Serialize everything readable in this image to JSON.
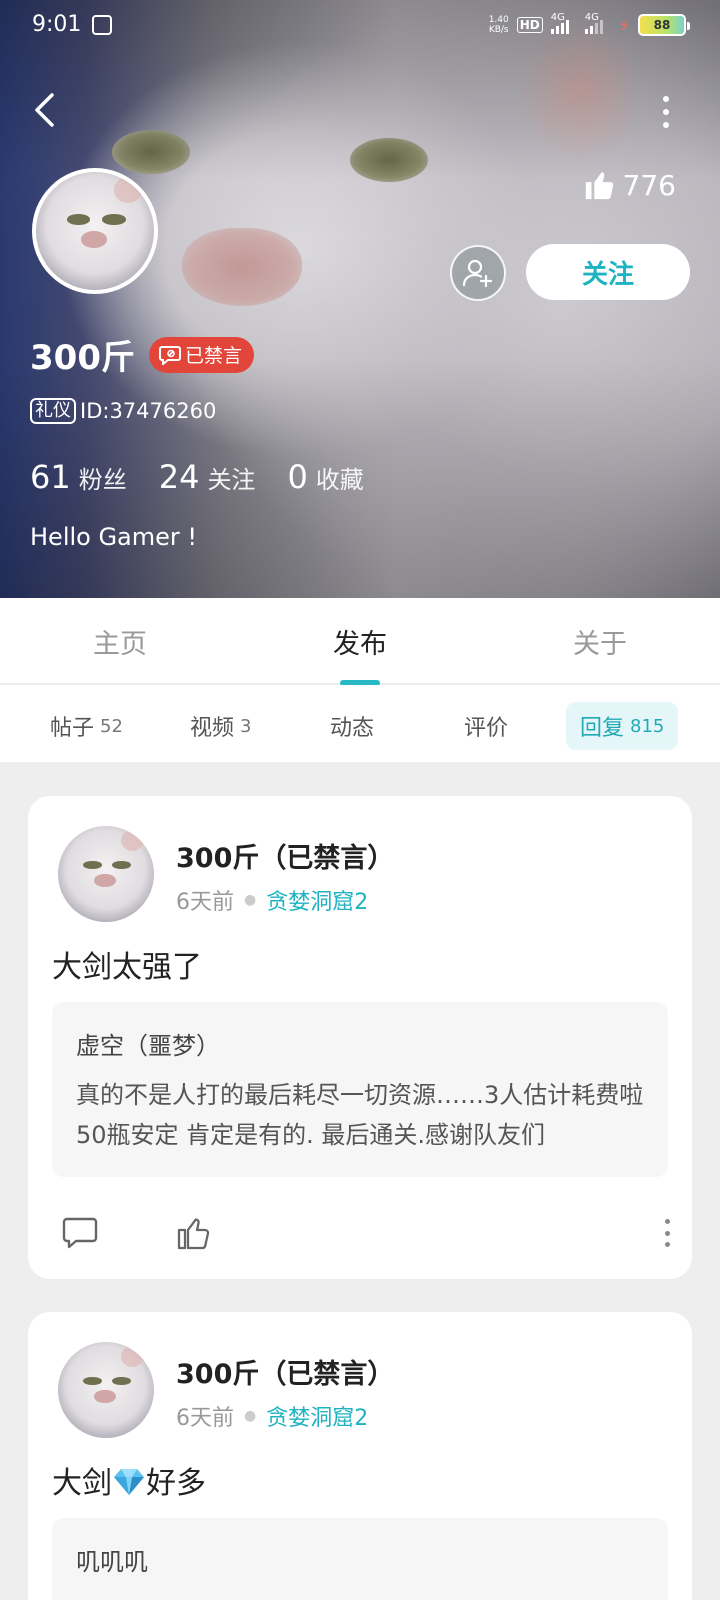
{
  "status_bar": {
    "time": "9:01",
    "net_speed_top": "1.40",
    "net_speed_bottom": "KB/s",
    "hd_label": "HD",
    "sim1_label": "4G",
    "sim2_label": "4G",
    "battery": "88"
  },
  "profile": {
    "likes": "776",
    "follow_label": "关注",
    "username": "300斤",
    "ban_label": "已禁言",
    "id_tag": "礼仪",
    "id_text": "ID:37476260",
    "stats": [
      {
        "num": "61",
        "label": "粉丝"
      },
      {
        "num": "24",
        "label": "关注"
      },
      {
        "num": "0",
        "label": "收藏"
      }
    ],
    "bio": "Hello Gamer !"
  },
  "tabs": [
    {
      "label": "主页",
      "active": false
    },
    {
      "label": "发布",
      "active": true
    },
    {
      "label": "关于",
      "active": false
    }
  ],
  "subtabs": [
    {
      "label": "帖子",
      "count": "52"
    },
    {
      "label": "视频",
      "count": "3"
    },
    {
      "label": "动态",
      "count": ""
    },
    {
      "label": "评价",
      "count": ""
    },
    {
      "label": "回复",
      "count": "815",
      "active": true
    }
  ],
  "posts": [
    {
      "author": "300斤（已禁言）",
      "time": "6天前",
      "game": "贪婪洞窟2",
      "body": "大剑太强了",
      "quote_title": "虚空（噩梦）",
      "quote_text": "真的不是人打的最后耗尽一切资源……3人估计耗费啦50瓶安定 肯定是有的. 最后通关.感谢队友们"
    },
    {
      "author": "300斤（已禁言）",
      "time": "6天前",
      "game": "贪婪洞窟2",
      "body_before": "大剑",
      "body_after": "好多",
      "quote_title": "叽叽叽"
    }
  ],
  "colors": {
    "accent": "#1fb3c2",
    "ban": "#e2463b"
  }
}
